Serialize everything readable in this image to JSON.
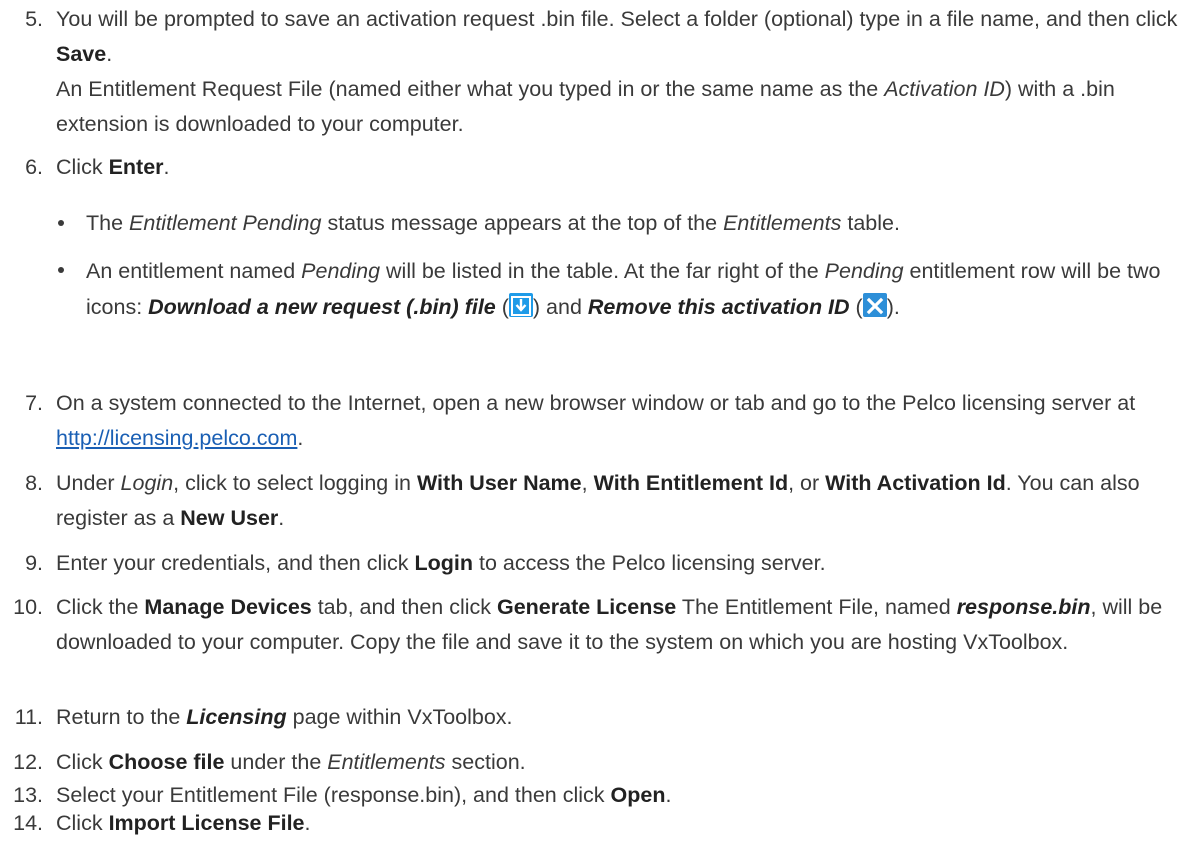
{
  "steps": {
    "s5": {
      "num": "5.",
      "p1a": "You will be prompted to save an activation request .bin file. Select a folder (optional) type in a file name, and then click ",
      "p1b": "Save",
      "p1c": ".",
      "p2a": "An Entitlement Request File (named either what you typed in or the same name as the ",
      "p2b": "Activation ID",
      "p2c": ") with a .bin extension is downloaded to your computer."
    },
    "s6": {
      "num": "6.",
      "a": "Click ",
      "b": "Enter",
      "c": ".",
      "bullet1": {
        "a": "The ",
        "b": "Entitlement Pending",
        "c": " status message appears at the top of the ",
        "d": "Entitlements",
        "e": " table."
      },
      "bullet2": {
        "a": "An entitlement named ",
        "b": "Pending",
        "c": " will be listed in the table. At the far right of the ",
        "d": "Pending",
        "e": " entitlement row will be two icons: ",
        "f": "Download a new request (.bin) file",
        "g": " (",
        "h": ") and ",
        "i": "Remove this activation ID",
        "j": " (",
        "k": ")."
      }
    },
    "s7": {
      "num": "7.",
      "a": "On a system connected to the Internet, open a new browser window or tab and go to the Pelco licensing server at ",
      "link": "http://licensing.pelco.com",
      "c": "."
    },
    "s8": {
      "num": "8.",
      "a": "Under ",
      "b": "Login",
      "c": ", click to select logging in ",
      "d": "With User Name",
      "e": ", ",
      "f": "With Entitlement Id",
      "g": ", or ",
      "h": "With Activation Id",
      "i": ". You can also register as a ",
      "j": "New User",
      "k": "."
    },
    "s9": {
      "num": "9.",
      "a": "Enter your credentials, and then click ",
      "b": "Login",
      "c": " to access the Pelco licensing server."
    },
    "s10": {
      "num": "10.",
      "a": "Click the ",
      "b": "Manage Devices",
      "c": " tab, and then click ",
      "d": "Generate License",
      "e": " The Entitlement File, named ",
      "f": "response.bin",
      "g": ", will be downloaded to your computer. Copy the file and save it to the system on which you are hosting VxToolbox."
    },
    "s11": {
      "num": "11.",
      "a": "Return to the ",
      "b": "Licensing",
      "c": " page within VxToolbox."
    },
    "s12": {
      "num": "12.",
      "a": "Click ",
      "b": "Choose file",
      "c": " under the ",
      "d": "Entitlements",
      "e": " section."
    },
    "s13": {
      "num": "13.",
      "a": "Select your Entitlement File (response.bin), and then click ",
      "b": "Open",
      "c": "."
    },
    "s14": {
      "num": "14.",
      "a": "Click ",
      "b": "Import License File",
      "c": "."
    }
  },
  "icons": {
    "download": "download-request-icon",
    "remove": "remove-activation-icon",
    "download_color": "#1e9be8",
    "remove_color": "#2d8fd8"
  },
  "colors": {
    "text": "#3a3a3a",
    "link": "#1a5fb4"
  }
}
